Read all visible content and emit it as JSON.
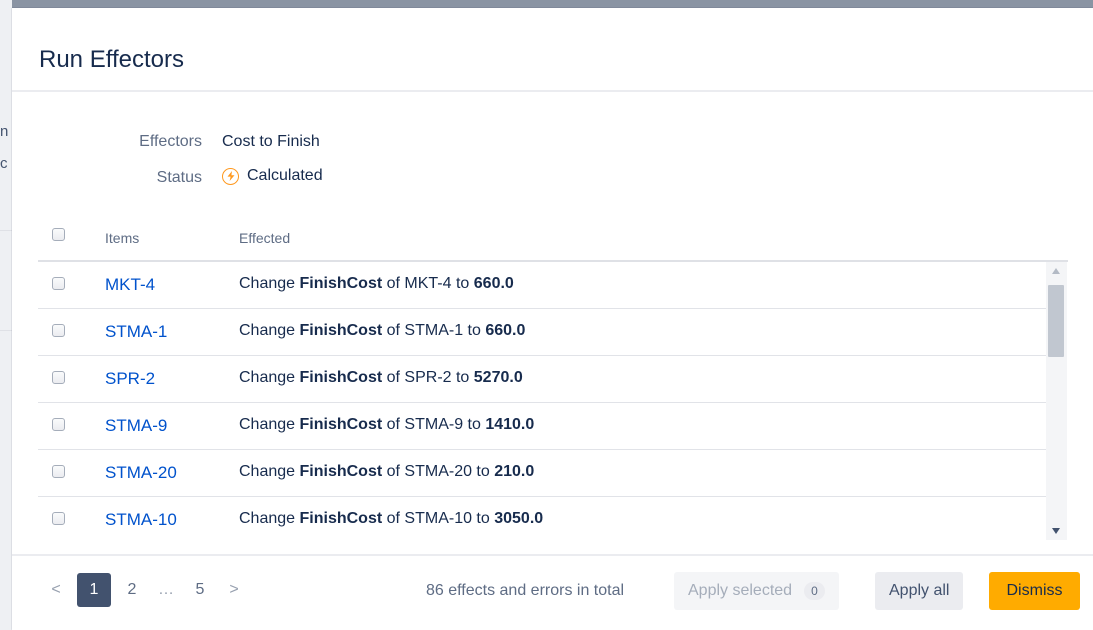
{
  "backdrop": {
    "snippet_1": "n",
    "snippet_2": "c"
  },
  "dialog": {
    "title": "Run Effectors",
    "effectors_label": "Effectors",
    "effectors_value": "Cost to Finish",
    "status_label": "Status",
    "status_value": "Calculated",
    "status_icon": "lightning-bolt-icon"
  },
  "table": {
    "columns": [
      "Items",
      "Effected"
    ],
    "rows": [
      {
        "key": "MKT-4",
        "verb": "Change",
        "field": "FinishCost",
        "mid": "of MKT-4 to",
        "value": "660.0"
      },
      {
        "key": "STMA-1",
        "verb": "Change",
        "field": "FinishCost",
        "mid": "of STMA-1 to",
        "value": "660.0"
      },
      {
        "key": "SPR-2",
        "verb": "Change",
        "field": "FinishCost",
        "mid": "of SPR-2 to",
        "value": "5270.0"
      },
      {
        "key": "STMA-9",
        "verb": "Change",
        "field": "FinishCost",
        "mid": "of STMA-9 to",
        "value": "1410.0"
      },
      {
        "key": "STMA-20",
        "verb": "Change",
        "field": "FinishCost",
        "mid": "of STMA-20 to",
        "value": "210.0"
      },
      {
        "key": "STMA-10",
        "verb": "Change",
        "field": "FinishCost",
        "mid": "of STMA-10 to",
        "value": "3050.0"
      }
    ]
  },
  "pagination": {
    "prev": "<",
    "next": ">",
    "pages": [
      "1",
      "2",
      "…",
      "5"
    ],
    "current": "1"
  },
  "footer": {
    "total_text": "86 effects and errors in total",
    "apply_selected_label": "Apply selected",
    "selected_count": "0",
    "apply_all_label": "Apply all",
    "dismiss_label": "Dismiss"
  },
  "colors": {
    "accent": "#0052cc",
    "primary_button": "#ffab00",
    "current_page": "#42526e",
    "status_icon": "#ff991f"
  }
}
